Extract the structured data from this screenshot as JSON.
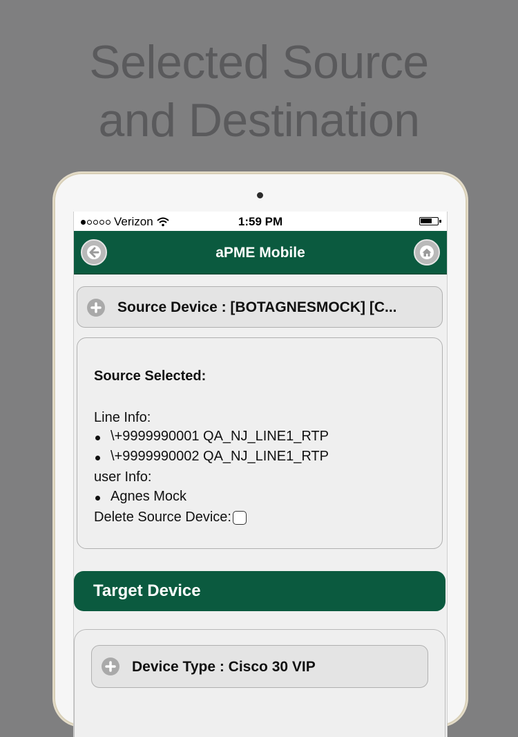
{
  "headline": {
    "line1": "Selected Source",
    "line2": "and Destination"
  },
  "statusbar": {
    "carrier": "Verizon",
    "time": "1:59 PM",
    "signal_dots_filled": 1,
    "signal_dots_total": 5
  },
  "navbar": {
    "title": "aPME Mobile",
    "back_icon": "back-arrow-icon",
    "home_icon": "home-icon"
  },
  "source_section": {
    "header": "Source Device : [BOTAGNESMOCK] [C...",
    "heading": "Source Selected:",
    "line_info_label": "Line Info:",
    "lines": [
      "\\+9999990001 QA_NJ_LINE1_RTP",
      "\\+9999990002 QA_NJ_LINE1_RTP"
    ],
    "user_info_label": "user Info:",
    "users": [
      "Agnes Mock"
    ],
    "delete_label": "Delete Source Device:",
    "delete_checked": false
  },
  "target_section": {
    "title": "Target Device",
    "device_type_label": "Device Type : Cisco 30 VIP"
  },
  "colors": {
    "background": "#7f7f80",
    "brand_green": "#0b5a3f",
    "headline_text": "#5a5a5c"
  }
}
